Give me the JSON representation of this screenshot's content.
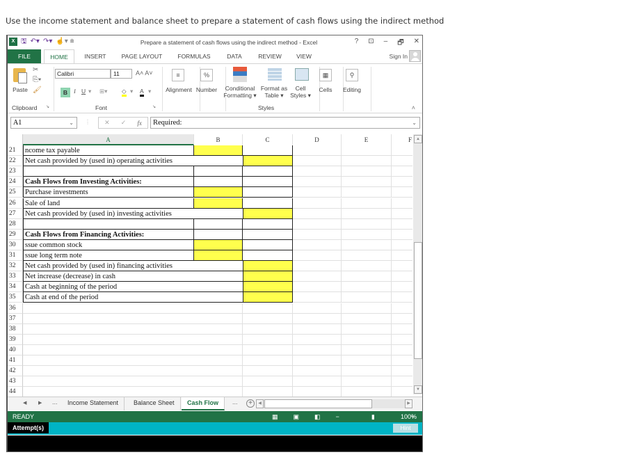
{
  "instruction": "Use the income statement and balance sheet to prepare a statement of cash flows using the indirect method",
  "window": {
    "title": "Prepare a statement of cash flows using the indirect method - Excel",
    "controls": [
      "?",
      "⊡",
      "–",
      "🗗",
      "✕"
    ],
    "sign_in": "Sign In"
  },
  "ribbon_tabs": [
    "FILE",
    "HOME",
    "INSERT",
    "PAGE LAYOUT",
    "FORMULAS",
    "DATA",
    "REVIEW",
    "VIEW"
  ],
  "ribbon": {
    "paste": "Paste",
    "clipboard": "Clipboard",
    "font_name": "Calibri",
    "font_size": "11",
    "font_group": "Font",
    "bold": "B",
    "italic": "I",
    "underline": "U",
    "alignment": "Alignment",
    "number": "Number",
    "conditional_formatting": [
      "Conditional",
      "Formatting ▾"
    ],
    "format_as_table": [
      "Format as",
      "Table ▾"
    ],
    "cell_styles": [
      "Cell",
      "Styles ▾"
    ],
    "styles_group": "Styles",
    "cells": "Cells",
    "editing": "Editing"
  },
  "formula_bar": {
    "name_box": "A1",
    "formula": "Required:"
  },
  "columns": [
    "A",
    "B",
    "C",
    "D",
    "E",
    "F"
  ],
  "rows": [
    {
      "num": "21",
      "label": "ncome tax payable",
      "bold": false,
      "b_yellow": true,
      "c_yellow": false
    },
    {
      "num": "22",
      "label": "Net cash provided by (used in) operating activities",
      "bold": false,
      "b_yellow": false,
      "c_yellow": true
    },
    {
      "num": "23",
      "label": "",
      "bold": false,
      "b_yellow": false,
      "c_yellow": false
    },
    {
      "num": "24",
      "label": "Cash Flows from Investing Activities:",
      "bold": true,
      "b_yellow": false,
      "c_yellow": false
    },
    {
      "num": "25",
      "label": "Purchase investments",
      "bold": false,
      "b_yellow": true,
      "c_yellow": false
    },
    {
      "num": "26",
      "label": "Sale of land",
      "bold": false,
      "b_yellow": true,
      "c_yellow": false
    },
    {
      "num": "27",
      "label": "Net cash provided by (used in) investing activities",
      "bold": false,
      "b_yellow": false,
      "c_yellow": true
    },
    {
      "num": "28",
      "label": "",
      "bold": false,
      "b_yellow": false,
      "c_yellow": false
    },
    {
      "num": "29",
      "label": "Cash Flows from Financing Activities:",
      "bold": true,
      "b_yellow": false,
      "c_yellow": false
    },
    {
      "num": "30",
      "label": "ssue common stock",
      "bold": false,
      "b_yellow": true,
      "c_yellow": false
    },
    {
      "num": "31",
      "label": "ssue long term note",
      "bold": false,
      "b_yellow": true,
      "c_yellow": false
    },
    {
      "num": "32",
      "label": "Net cash provided by (used in) financing activities",
      "bold": false,
      "b_yellow": false,
      "c_yellow": true
    },
    {
      "num": "33",
      "label": "Net increase (decrease) in cash",
      "bold": false,
      "b_yellow": false,
      "c_yellow": true
    },
    {
      "num": "34",
      "label": "Cash at beginning of the period",
      "bold": false,
      "b_yellow": false,
      "c_yellow": true
    },
    {
      "num": "35",
      "label": "Cash at end of the period",
      "bold": false,
      "b_yellow": false,
      "c_yellow": true
    },
    {
      "num": "36",
      "label": ""
    },
    {
      "num": "37",
      "label": ""
    },
    {
      "num": "38",
      "label": ""
    },
    {
      "num": "39",
      "label": ""
    },
    {
      "num": "40",
      "label": ""
    },
    {
      "num": "41",
      "label": ""
    },
    {
      "num": "42",
      "label": ""
    },
    {
      "num": "43",
      "label": ""
    },
    {
      "num": "44",
      "label": ""
    }
  ],
  "sheet_tabs": {
    "ellipsis": "...",
    "tabs": [
      "Income Statement",
      "Balance Sheet",
      "Cash Flow"
    ],
    "active": "Cash Flow"
  },
  "status": {
    "ready": "READY",
    "zoom": "100%"
  },
  "footer": {
    "attempts": "Attempt(s)",
    "hint": "Hint"
  },
  "colors": {
    "excel_green": "#217346",
    "input_yellow": "#ffff4d",
    "attempt_bar": "#00b4c5"
  }
}
